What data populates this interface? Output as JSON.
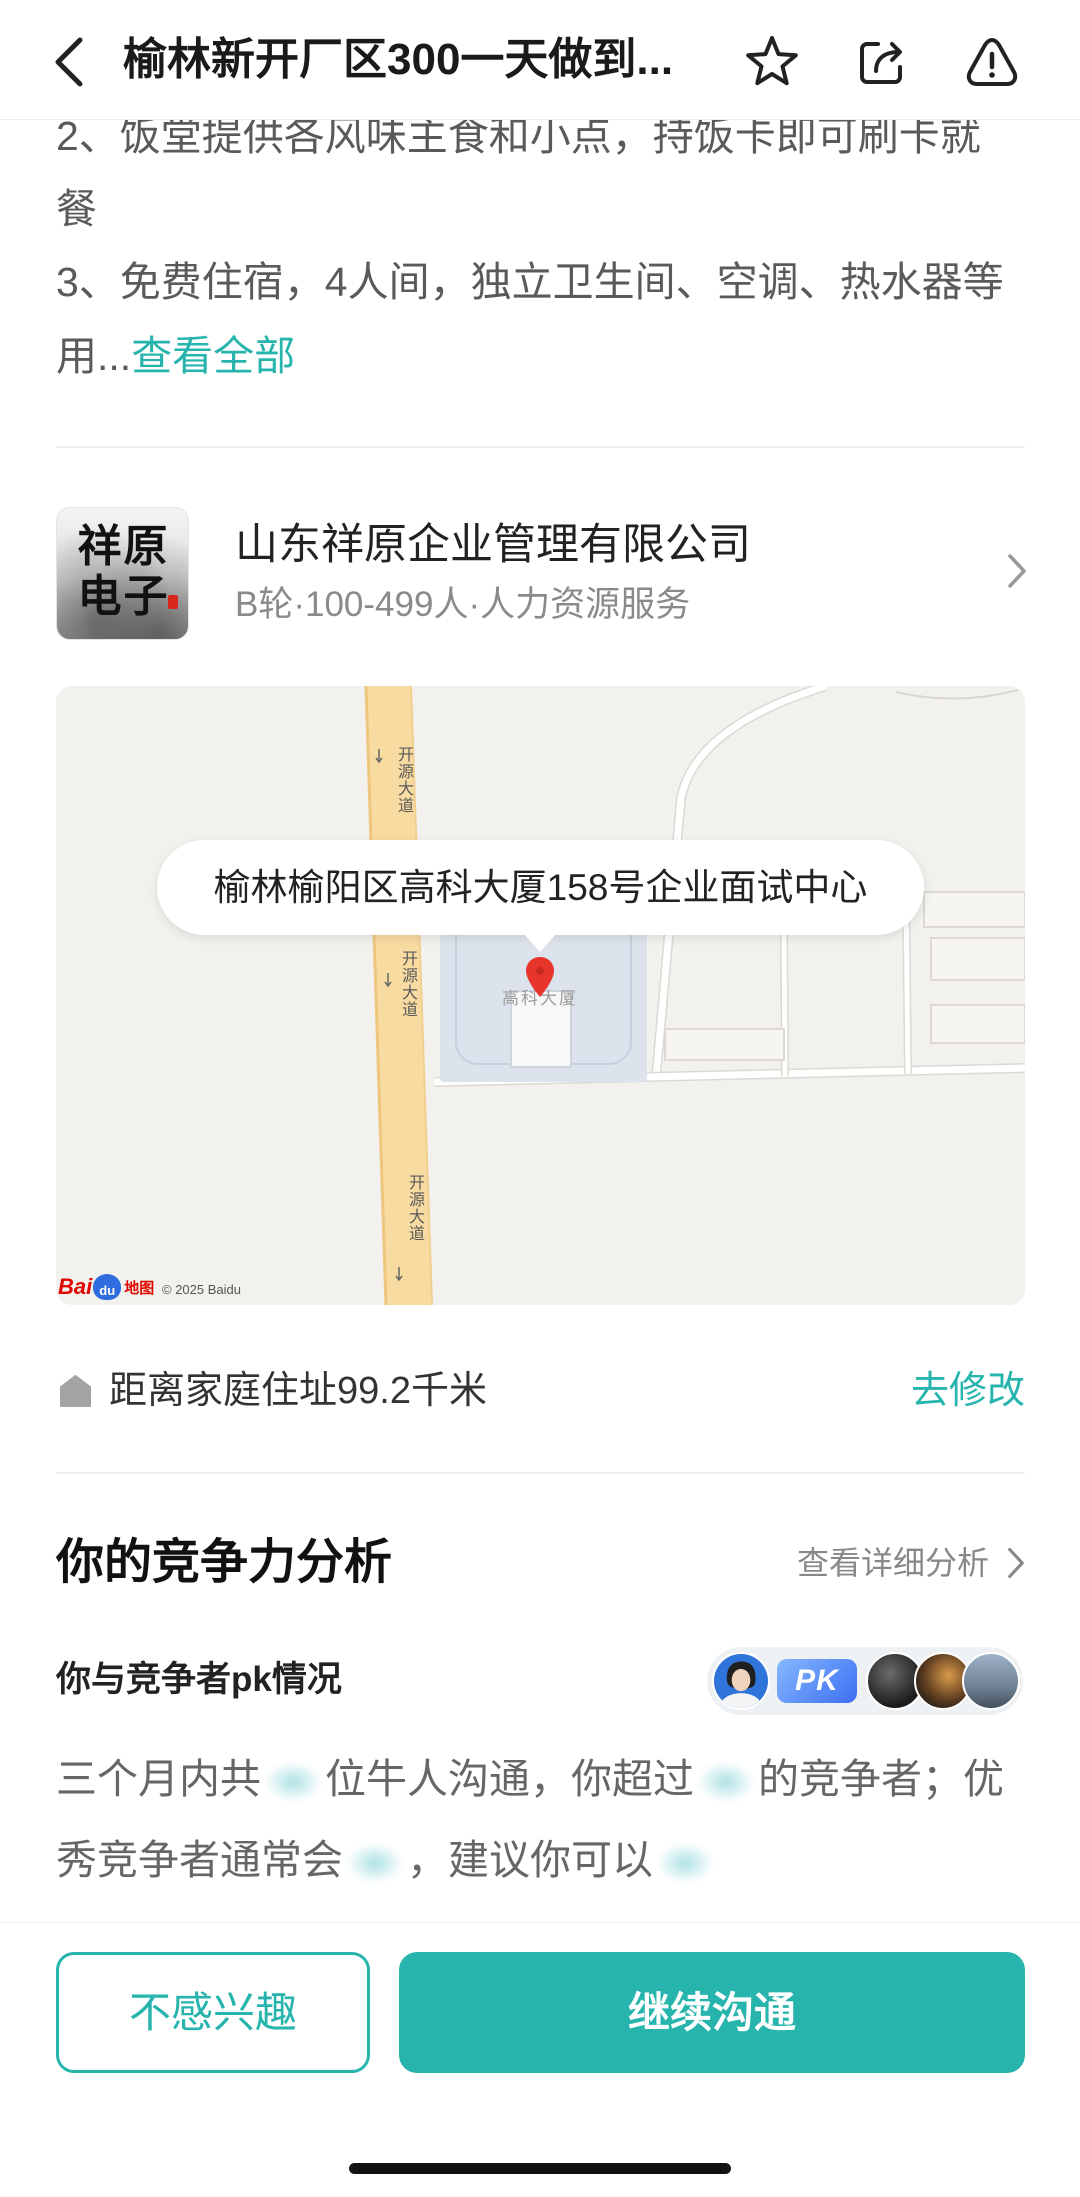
{
  "header": {
    "title": "榆林新开厂区300一天做到...",
    "icons": {
      "back": "chevron-left-icon",
      "favorite": "star-icon",
      "share": "share-icon",
      "report": "warning-icon"
    }
  },
  "description": {
    "lines": [
      "2、饭堂提供各风味主食和小点，持饭卡即可刷卡就",
      "餐",
      "3、免费住宿，4人间，独立卫生间、空调、热水器等",
      "用..."
    ],
    "expand_link": "查看全部"
  },
  "company": {
    "logo_lines": [
      "祥原",
      "电子"
    ],
    "name": "山东祥原企业管理有限公司",
    "meta": "B轮·100-499人·人力资源服务"
  },
  "map": {
    "address": "榆林榆阳区高科大厦158号企业面试中心",
    "road_label": "开源大道",
    "building_label": "高科大厦",
    "copyright": "© 2025 Baidu",
    "logo": {
      "bai": "Bai",
      "du": "du",
      "map": "地图"
    },
    "pin_icon": "map-pin-icon"
  },
  "distance": {
    "icon": "home-icon",
    "text": "距离家庭住址99.2千米",
    "edit_link": "去修改"
  },
  "competitiveness": {
    "title": "你的竞争力分析",
    "detail_link": "查看详细分析",
    "pk_label": "你与竞争者pk情况",
    "pk_badge": "PK",
    "summary": {
      "line1": [
        "三个月内共",
        "位牛人沟通，你超过",
        "的竞争者；优"
      ],
      "line2": [
        "秀竞争者通常会",
        "，建议你可以"
      ]
    }
  },
  "actions": {
    "not_interested": "不感兴趣",
    "continue_chat": "继续沟通"
  },
  "colors": {
    "accent": "#26b4ad",
    "pin": "#e8352b",
    "road": "#f8dba0"
  }
}
